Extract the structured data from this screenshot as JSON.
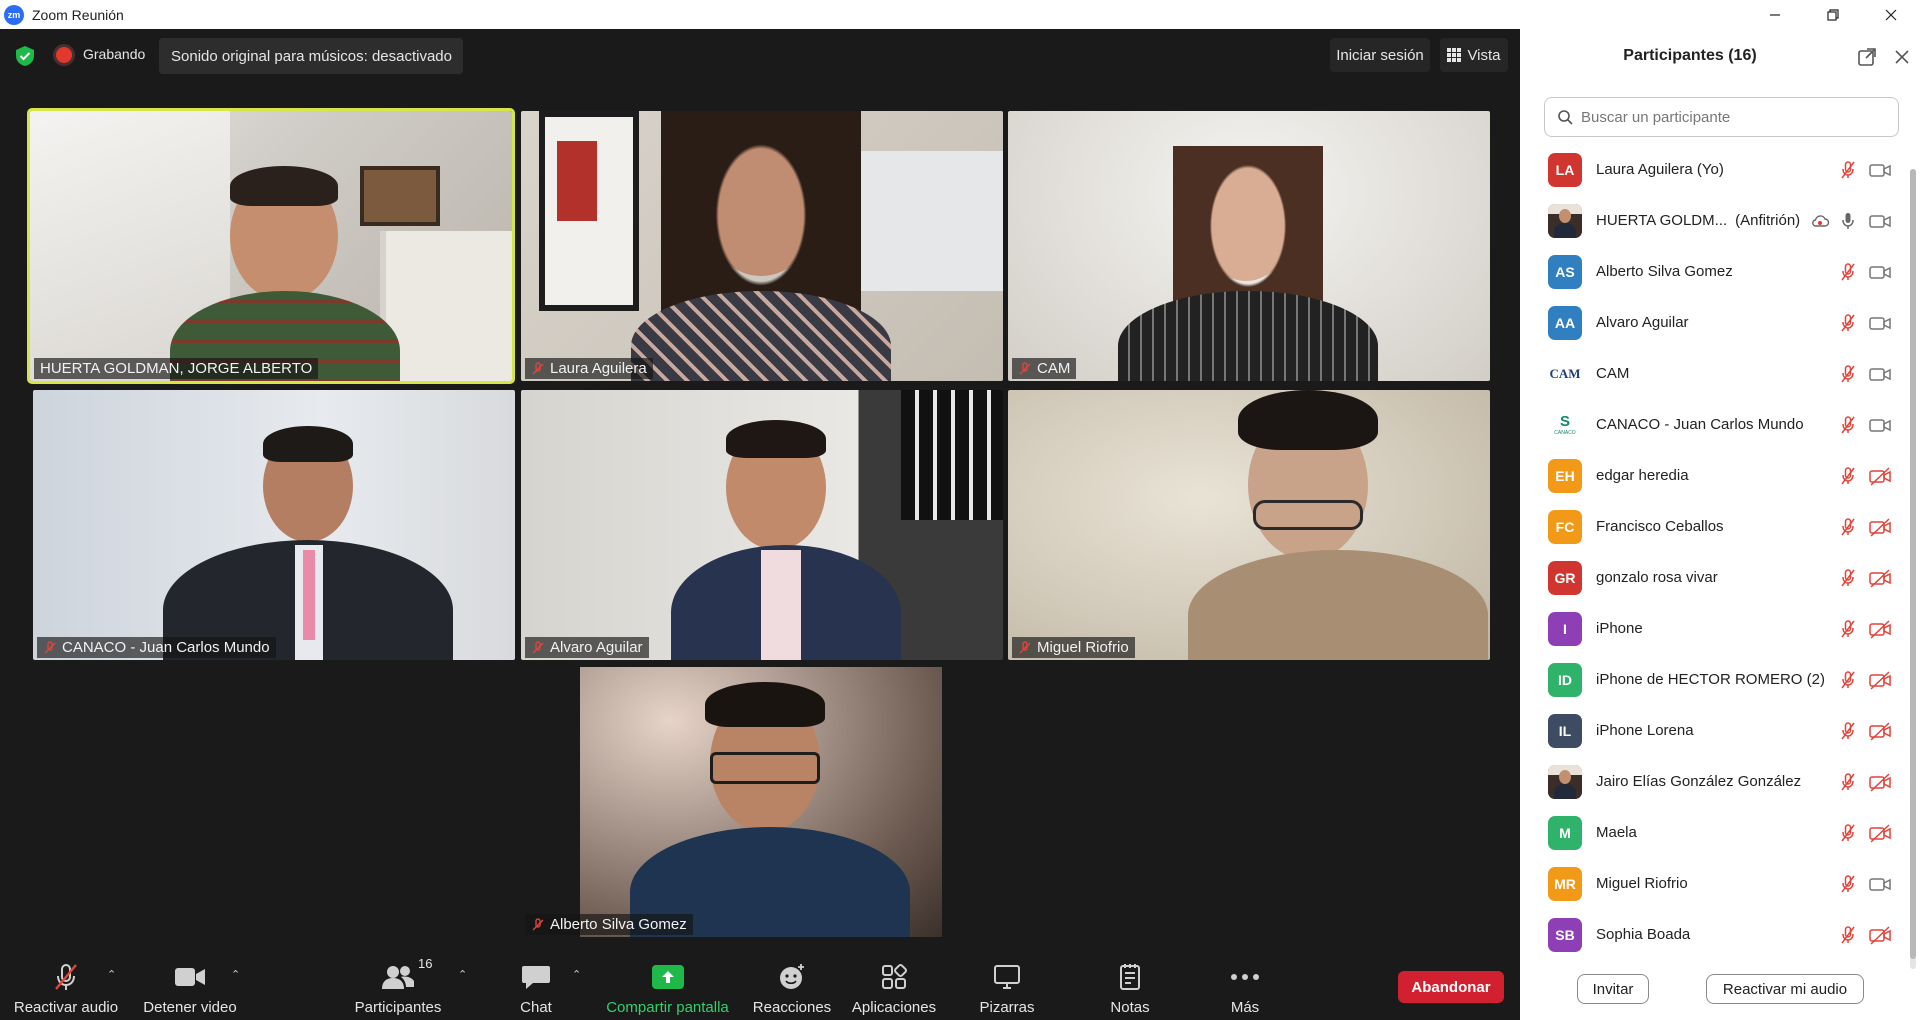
{
  "window": {
    "title": "Zoom Reunión",
    "app_logo": "zm"
  },
  "topbar": {
    "recording_label": "Grabando",
    "sound_notice": "Sonido original para músicos: desactivado",
    "signin_label": "Iniciar sesión",
    "view_label": "Vista"
  },
  "tiles": [
    {
      "name": "HUERTA GOLDMAN, JORGE ALBERTO",
      "muted": false,
      "active": true
    },
    {
      "name": "Laura Aguilera",
      "muted": true,
      "active": false
    },
    {
      "name": "CAM",
      "muted": true,
      "active": false
    },
    {
      "name": "CANACO - Juan Carlos Mundo",
      "muted": true,
      "active": false
    },
    {
      "name": "Alvaro Aguilar",
      "muted": true,
      "active": false
    },
    {
      "name": "Miguel Riofrio",
      "muted": true,
      "active": false
    },
    {
      "name": "Alberto Silva Gomez",
      "muted": true,
      "active": false
    }
  ],
  "toolbar": {
    "audio": "Reactivar audio",
    "video": "Detener video",
    "participants": "Participantes",
    "participants_count": "16",
    "chat": "Chat",
    "share": "Compartir pantalla",
    "reactions": "Reacciones",
    "apps": "Aplicaciones",
    "whiteboards": "Pizarras",
    "notes": "Notas",
    "more": "Más",
    "leave": "Abandonar"
  },
  "panel": {
    "title": "Participantes (16)",
    "search_placeholder": "Buscar un participante",
    "invite": "Invitar",
    "unmute_me": "Reactivar mi audio",
    "participants": [
      {
        "initials": "LA",
        "name": "Laura Aguilera (Yo)",
        "color": "#d0362f",
        "mic": "muted",
        "cam": "on"
      },
      {
        "initials": "",
        "name": "HUERTA GOLDM...",
        "host": "(Anfitrión)",
        "color": "#4a3a34",
        "mic": "on",
        "cam": "on",
        "photo": true,
        "cloud": true
      },
      {
        "initials": "AS",
        "name": "Alberto Silva Gomez",
        "color": "#2f7fc1",
        "mic": "muted",
        "cam": "on"
      },
      {
        "initials": "AA",
        "name": "Alvaro Aguilar",
        "color": "#2f7fc1",
        "mic": "muted",
        "cam": "on"
      },
      {
        "initials": "CAM",
        "name": "CAM",
        "color": "#ffffff",
        "mic": "muted",
        "cam": "on",
        "logo": "cam"
      },
      {
        "initials": "S",
        "name": "CANACO - Juan Carlos Mundo",
        "color": "#ffffff",
        "mic": "muted",
        "cam": "on",
        "logo": "canaco",
        "logo_caption": "CANACO"
      },
      {
        "initials": "EH",
        "name": "edgar heredia",
        "color": "#f29a17",
        "mic": "muted",
        "cam": "off"
      },
      {
        "initials": "FC",
        "name": "Francisco Ceballos",
        "color": "#f29a17",
        "mic": "muted",
        "cam": "off"
      },
      {
        "initials": "GR",
        "name": "gonzalo rosa vivar",
        "color": "#d0362f",
        "mic": "muted",
        "cam": "off"
      },
      {
        "initials": "I",
        "name": "iPhone",
        "color": "#8e3fb5",
        "mic": "muted",
        "cam": "off"
      },
      {
        "initials": "ID",
        "name": "iPhone de HECTOR ROMERO (2)",
        "color": "#2fb36a",
        "mic": "muted",
        "cam": "off"
      },
      {
        "initials": "IL",
        "name": "iPhone Lorena",
        "color": "#3d4b63",
        "mic": "muted",
        "cam": "off"
      },
      {
        "initials": "",
        "name": "Jairo Elías González González",
        "color": "#5b5b5b",
        "mic": "muted",
        "cam": "off",
        "photo": true
      },
      {
        "initials": "M",
        "name": "Maela",
        "color": "#2fb36a",
        "mic": "muted",
        "cam": "off"
      },
      {
        "initials": "MR",
        "name": "Miguel Riofrio",
        "color": "#f29a17",
        "mic": "muted",
        "cam": "on"
      },
      {
        "initials": "SB",
        "name": "Sophia Boada",
        "color": "#8e3fb5",
        "mic": "muted",
        "cam": "off"
      }
    ]
  },
  "colors": {
    "accent_active": "#d6e646",
    "leave": "#d1202f",
    "share": "#1fb94a",
    "muted_red": "#e0443a"
  }
}
